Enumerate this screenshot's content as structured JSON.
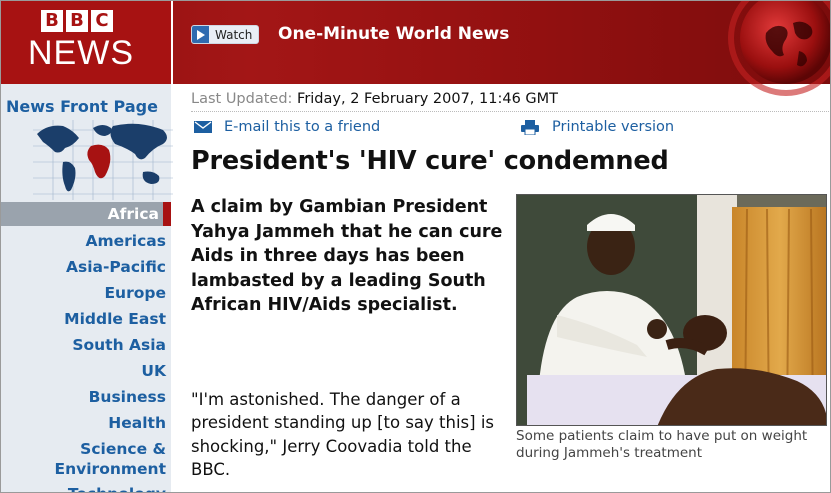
{
  "header": {
    "brand_letters": [
      "B",
      "B",
      "C"
    ],
    "brand_word": "NEWS",
    "watch_label": "Watch",
    "promo_title": "One-Minute World News"
  },
  "sidebar": {
    "front_page": "News Front Page",
    "items": [
      {
        "label": "Africa",
        "active": true
      },
      {
        "label": "Americas"
      },
      {
        "label": "Asia-Pacific"
      },
      {
        "label": "Europe"
      },
      {
        "label": "Middle East"
      },
      {
        "label": "South Asia"
      },
      {
        "label": "UK"
      },
      {
        "label": "Business"
      },
      {
        "label": "Health"
      },
      {
        "label": "Science &\nEnvironment"
      },
      {
        "label": "Technology"
      }
    ]
  },
  "article": {
    "updated_label": "Last Updated:",
    "updated_value": "Friday, 2 February 2007, 11:46 GMT",
    "email_link": "E-mail this to a friend",
    "print_link": "Printable version",
    "headline": "President's 'HIV cure' condemned",
    "lead": "A claim by Gambian President Yahya Jammeh that he can cure Aids in three days has been lambasted by a leading South African HIV/Aids specialist.",
    "body": "\"I'm astonished. The danger of a president standing up [to say this] is shocking,\" Jerry Coovadia told the BBC.",
    "caption": "Some patients claim to have put on weight during Jammeh's treatment"
  },
  "colors": {
    "brand_red": "#a71212",
    "link_blue": "#1d5fa1",
    "sidebar_bg": "#e6ebf1"
  },
  "icons": [
    "play-icon",
    "globe-graphic",
    "world-map",
    "envelope-icon",
    "printer-icon"
  ]
}
